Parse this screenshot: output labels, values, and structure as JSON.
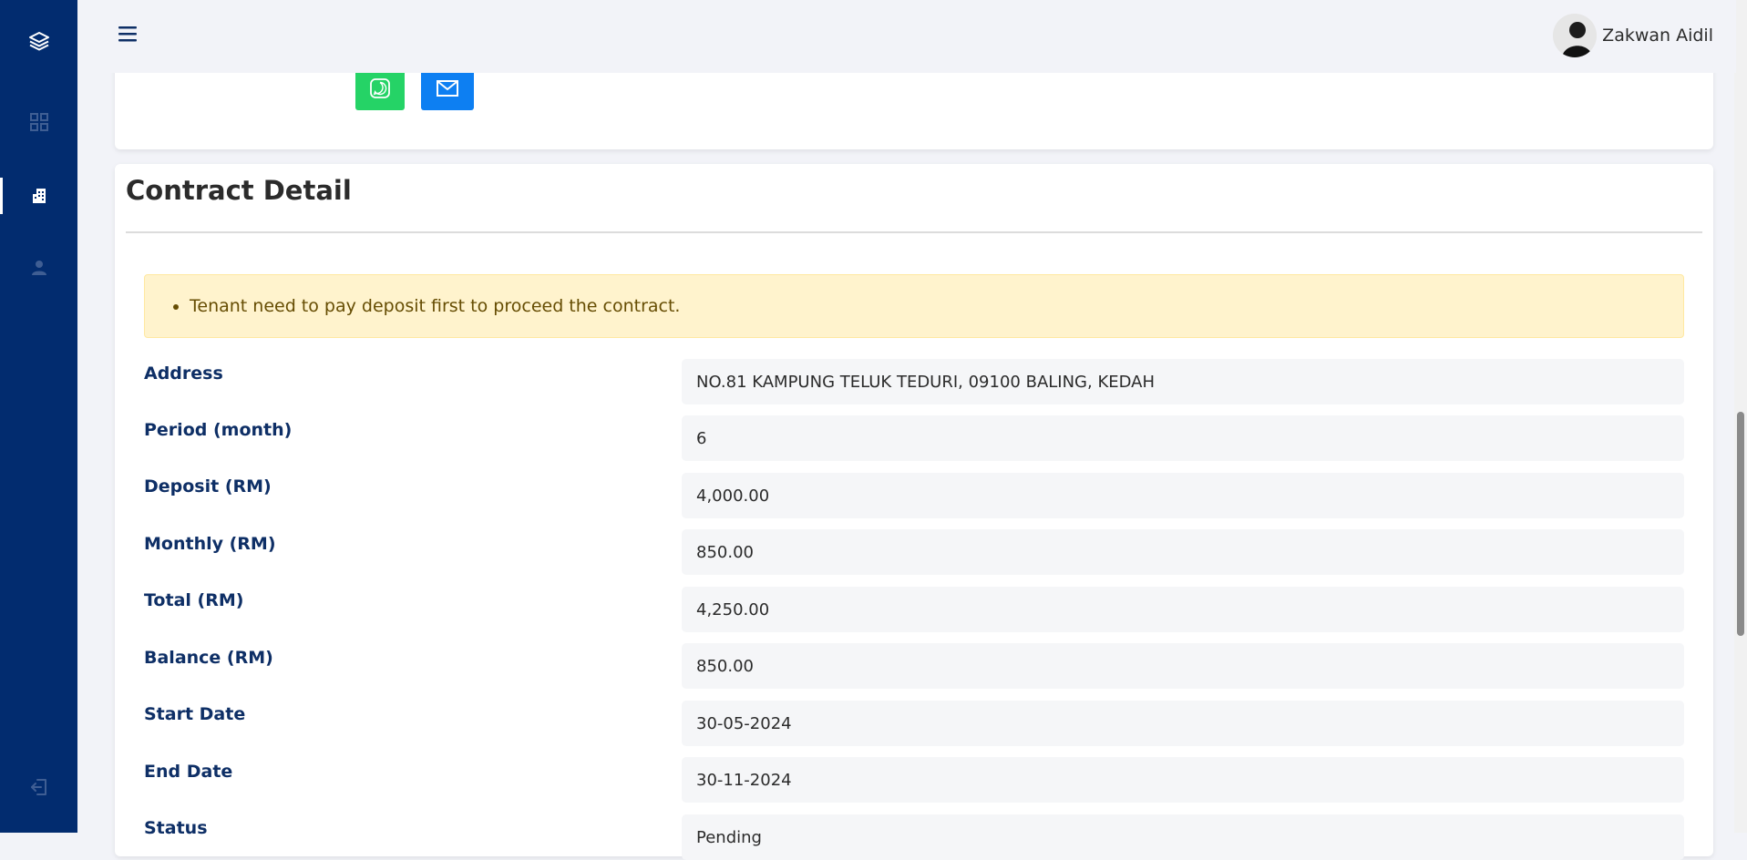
{
  "user": {
    "name": "Zakwan Aidil"
  },
  "sidebar": {
    "items": [
      {
        "icon": "layers-icon"
      },
      {
        "icon": "grid-icon"
      },
      {
        "icon": "building-icon"
      },
      {
        "icon": "user-icon"
      },
      {
        "icon": "logout-icon"
      }
    ]
  },
  "contact_buttons": [
    {
      "icon": "whatsapp-icon",
      "color": "#25d366"
    },
    {
      "icon": "mail-icon",
      "color": "#0d7ff2"
    }
  ],
  "contract": {
    "title": "Contract Detail",
    "alert": "Tenant need to pay deposit first to proceed the contract.",
    "fields": [
      {
        "label": "Address",
        "value": "NO.81 KAMPUNG TELUK TEDURI, 09100 BALING, KEDAH"
      },
      {
        "label": "Period (month)",
        "value": "6"
      },
      {
        "label": "Deposit (RM)",
        "value": "4,000.00"
      },
      {
        "label": "Monthly (RM)",
        "value": "850.00"
      },
      {
        "label": "Total (RM)",
        "value": "4,250.00"
      },
      {
        "label": "Balance (RM)",
        "value": "850.00"
      },
      {
        "label": "Start Date",
        "value": "30-05-2024"
      },
      {
        "label": "End Date",
        "value": "30-11-2024"
      },
      {
        "label": "Status",
        "value": "Pending"
      }
    ]
  },
  "colors": {
    "sidebar": "#022c6f",
    "label": "#0e2f66",
    "alert_bg": "#fff3cd",
    "alert_text": "#664d03"
  }
}
